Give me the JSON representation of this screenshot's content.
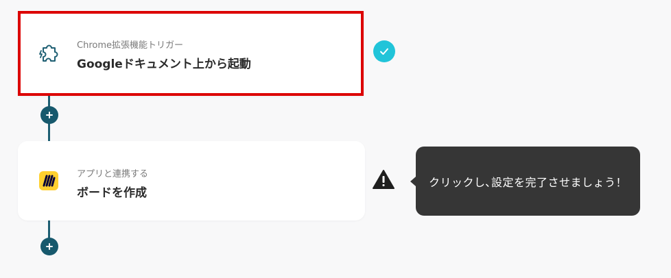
{
  "steps": [
    {
      "subtitle": "Chrome拡張機能トリガー",
      "title": "Googleドキュメント上から起動",
      "icon": "puzzle-piece-icon",
      "status": "complete",
      "selected": true
    },
    {
      "subtitle": "アプリと連携する",
      "title": "ボードを作成",
      "icon": "miro-logo",
      "status": "warning",
      "selected": false
    }
  ],
  "tooltip": {
    "text": "クリックし､設定を完了させましょう！"
  },
  "colors": {
    "accent_teal": "#17596d",
    "check_cyan": "#21c4d9",
    "selected_border": "#dc0000",
    "miro_yellow": "#ffd02f",
    "tooltip_bg": "#363636"
  }
}
